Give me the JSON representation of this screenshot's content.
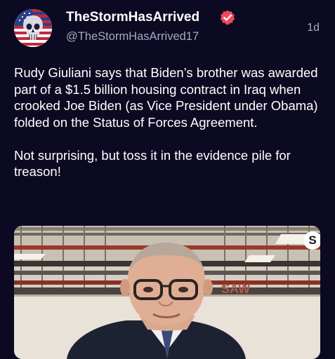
{
  "author": {
    "display_name": "TheStormHasArrived",
    "handle": "@TheStormHasArrived17",
    "verified": true,
    "verified_color": "#f0485f"
  },
  "post": {
    "timestamp": "1d",
    "paragraphs": [
      "Rudy Giuliani says that Biden’s brother was awarded part of a $1.5 billion housing contract in Iraq when crooked Joe Biden (as Vice President under Obama) folded on the Status of Forces Agreement.",
      "Not surprising, but toss it in the evidence pile for treason!"
    ]
  },
  "media": {
    "background_text": "SAW",
    "badge_glyph": "S"
  },
  "theme": {
    "background": "#0c0a22",
    "text": "#ffffff",
    "secondary_text": "#a9a7c2"
  }
}
